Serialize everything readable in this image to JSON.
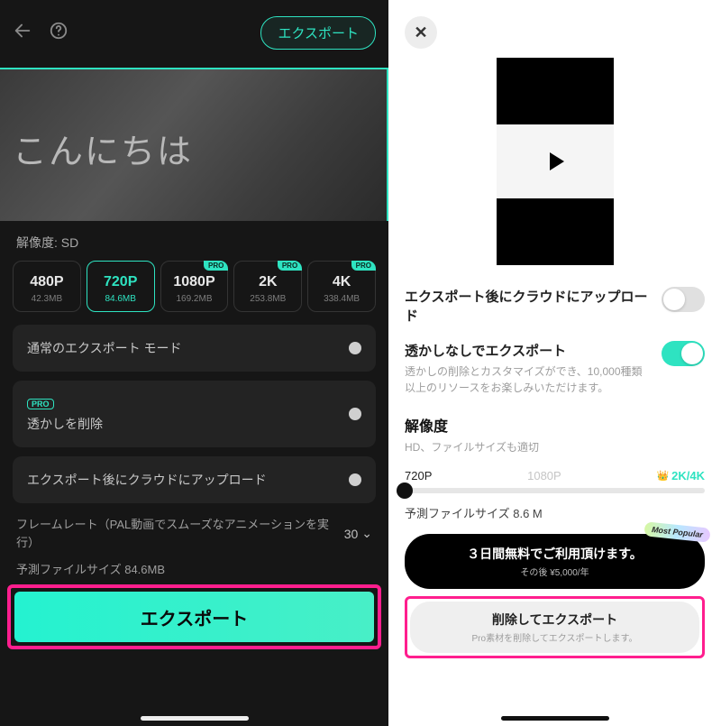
{
  "left": {
    "export_pill": "エクスポート",
    "greeting": "こんにちは",
    "resolution_label": "解像度: SD",
    "resolutions": [
      {
        "label": "480P",
        "size": "42.3MB",
        "pro": false
      },
      {
        "label": "720P",
        "size": "84.6MB",
        "pro": false,
        "selected": true
      },
      {
        "label": "1080P",
        "size": "169.2MB",
        "pro": true
      },
      {
        "label": "2K",
        "size": "253.8MB",
        "pro": true
      },
      {
        "label": "4K",
        "size": "338.4MB",
        "pro": true
      }
    ],
    "pro_tag": "PRO",
    "opt_normal": "通常のエクスポート モード",
    "opt_watermark": "透かしを削除",
    "opt_cloud": "エクスポート後にクラウドにアップロード",
    "frame_label": "フレームレート（PAL動画でスムーズなアニメーションを実行）",
    "frame_value": "30",
    "size_line": "予測ファイルサイズ 84.6MB",
    "export_btn": "エクスポート"
  },
  "right": {
    "cloud_title": "エクスポート後にクラウドにアップロード",
    "wm_title": "透かしなしでエクスポート",
    "wm_sub": "透かしの削除とカスタマイズができ、10,000種類以上のリソースをお楽しみいただけます。",
    "res_title": "解像度",
    "res_sub": "HD、ファイルサイズも適切",
    "slider": {
      "l1": "720P",
      "l2": "1080P",
      "l3": "2K/4K"
    },
    "pred_size": "予測ファイルサイズ 8.6 M",
    "trial_line1": "３日間無料でご利用頂けます。",
    "trial_line2": "その後 ¥5,000/年",
    "popular_tag": "Most Popular",
    "delete_line1": "削除してエクスポート",
    "delete_line2": "Pro素材を削除してエクスポートします。"
  }
}
